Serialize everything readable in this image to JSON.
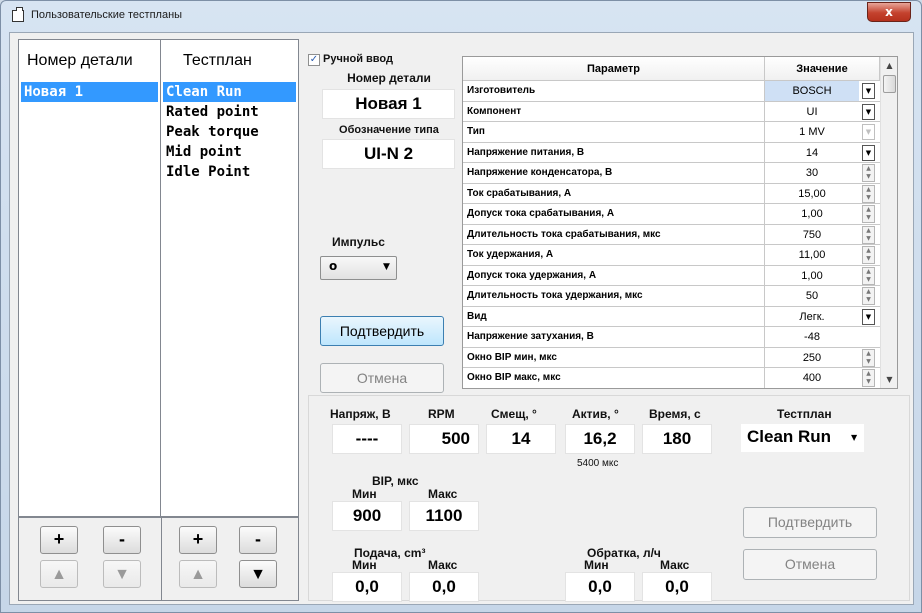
{
  "window": {
    "title": "Пользовательские тестпланы",
    "close_glyph": "x"
  },
  "parts_list": {
    "header": "Номер детали",
    "items": [
      "Новая 1"
    ],
    "add_label": "+",
    "remove_label": "-",
    "up_glyph": "▲",
    "down_glyph": "▼"
  },
  "testplan_list": {
    "header": "Тестплан",
    "items": [
      "Clean Run",
      "Rated point",
      "Peak torque",
      "Mid point",
      "Idle Point"
    ],
    "add_label": "+",
    "remove_label": "-",
    "up_glyph": "▲",
    "down_glyph": "▼"
  },
  "details": {
    "manual_input_label": "Ручной ввод",
    "manual_input_checked": true,
    "part_number_label": "Номер детали",
    "part_number_value": "Новая 1",
    "type_label": "Обозначение типа",
    "type_value": "UI-N 2",
    "pulse_label": "Импульс",
    "pulse_value": "о",
    "confirm_label": "Подтвердить",
    "cancel_label": "Отмена"
  },
  "grid": {
    "columns": [
      "Параметр",
      "Значение"
    ],
    "rows": [
      {
        "param": "Изготовитель",
        "value": "BOSCH",
        "control": "dropdown",
        "highlight": true
      },
      {
        "param": "Компонент",
        "value": "UI",
        "control": "dropdown"
      },
      {
        "param": "Тип",
        "value": "1 MV",
        "control": "dropdown-dim"
      },
      {
        "param": "Напряжение питания, В",
        "value": "14",
        "control": "dropdown"
      },
      {
        "param": "Напряжение конденсатора, В",
        "value": "30",
        "control": "spin"
      },
      {
        "param": "Ток срабатывания, А",
        "value": "15,00",
        "control": "spin"
      },
      {
        "param": "Допуск тока срабатывания, А",
        "value": "1,00",
        "control": "spin"
      },
      {
        "param": "Длительность тока срабатывания, мкс",
        "value": "750",
        "control": "spin"
      },
      {
        "param": "Ток удержания, А",
        "value": "11,00",
        "control": "spin"
      },
      {
        "param": "Допуск тока удержания, А",
        "value": "1,00",
        "control": "spin"
      },
      {
        "param": "Длительность тока удержания, мкс",
        "value": "50",
        "control": "spin"
      },
      {
        "param": "Вид",
        "value": "Легк.",
        "control": "dropdown"
      },
      {
        "param": "Напряжение затухания, В",
        "value": "-48",
        "control": "none"
      },
      {
        "param": "Окно BIP мин, мкс",
        "value": "250",
        "control": "spin"
      },
      {
        "param": "Окно BIP макс, мкс",
        "value": "400",
        "control": "spin"
      }
    ]
  },
  "bottom": {
    "voltage_label": "Напряж, В",
    "voltage_value": "----",
    "rpm_label": "RPM",
    "rpm_value": "500",
    "offset_label": "Смещ, °",
    "offset_value": "14",
    "active_label": "Актив, °",
    "active_value": "16,2",
    "active_sub": "5400 мкс",
    "time_label": "Время, с",
    "time_value": "180",
    "testplan_label": "Тестплан",
    "testplan_value": "Clean Run",
    "bip_label": "BIP, мкс",
    "bip_min_label": "Мин",
    "bip_min_value": "900",
    "bip_max_label": "Макс",
    "bip_max_value": "1100",
    "feed_label": "Подача, cm³",
    "feed_min_label": "Мин",
    "feed_min_value": "0,0",
    "feed_max_label": "Макс",
    "feed_max_value": "0,0",
    "return_label": "Обратка, л/ч",
    "return_min_label": "Мин",
    "return_min_value": "0,0",
    "return_max_label": "Макс",
    "return_max_value": "0,0",
    "confirm_label": "Подтвердить",
    "cancel_label": "Отмена"
  },
  "icons": {
    "dropdown": "caret-down-icon",
    "spin": "spinner-arrows-icon",
    "window": "window-icon"
  }
}
